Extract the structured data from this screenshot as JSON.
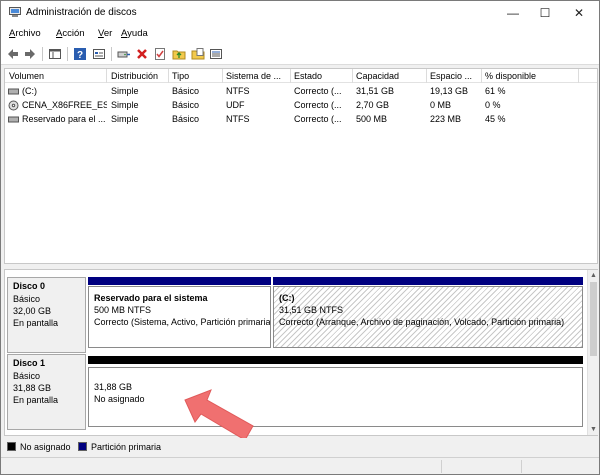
{
  "window": {
    "title": "Administración de discos",
    "minimize": "—",
    "maximize": "☐",
    "close": "✕"
  },
  "menu": [
    {
      "pre": "",
      "key": "A",
      "post": "rchivo"
    },
    {
      "pre": "",
      "key": "A",
      "post": "cción"
    },
    {
      "pre": "",
      "key": "V",
      "post": "er"
    },
    {
      "pre": "",
      "key": "A",
      "post": "yuda"
    }
  ],
  "toolbar": {
    "icons": [
      "back-arrow-icon",
      "forward-arrow-icon",
      "console-view-icon",
      "help-icon",
      "properties-icon",
      "connect-drive-icon",
      "delete-icon",
      "check-icon",
      "folder-up-icon",
      "open-folder-icon",
      "list-view-icon"
    ]
  },
  "volumes": {
    "columns": [
      "Volumen",
      "Distribución",
      "Tipo",
      "Sistema de ...",
      "Estado",
      "Capacidad",
      "Espacio ...",
      "% disponible"
    ],
    "rows": [
      {
        "icon": "volume-icon",
        "volume": "(C:)",
        "layout": "Simple",
        "type": "Básico",
        "fs": "NTFS",
        "status": "Correcto (...",
        "capacity": "31,51 GB",
        "free": "19,13 GB",
        "pct": "61 %"
      },
      {
        "icon": "cd-drive-icon",
        "volume": "CENA_X86FREE_ES...",
        "layout": "Simple",
        "type": "Básico",
        "fs": "UDF",
        "status": "Correcto (...",
        "capacity": "2,70 GB",
        "free": "0 MB",
        "pct": "0 %"
      },
      {
        "icon": "volume-icon",
        "volume": "Reservado para el ...",
        "layout": "Simple",
        "type": "Básico",
        "fs": "NTFS",
        "status": "Correcto (...",
        "capacity": "500 MB",
        "free": "223 MB",
        "pct": "45 %"
      }
    ]
  },
  "disks": [
    {
      "name": "Disco 0",
      "type": "Básico",
      "size": "32,00 GB",
      "state": "En pantalla",
      "partitions": [
        {
          "title": "Reservado para el sistema",
          "size": "500 MB NTFS",
          "status": "Correcto (Sistema, Activo, Partición primaria)"
        },
        {
          "title": "(C:)",
          "size": "31,51 GB NTFS",
          "status": "Correcto (Arranque, Archivo de paginación, Volcado, Partición primaria)"
        }
      ]
    },
    {
      "name": "Disco 1",
      "type": "Básico",
      "size": "31,88 GB",
      "state": "En pantalla",
      "partitions": [
        {
          "title": "",
          "size": "31,88 GB",
          "status": "No asignado"
        }
      ]
    }
  ],
  "legend": [
    {
      "label": "No asignado",
      "color": "#000000"
    },
    {
      "label": "Partición primaria",
      "color": "#000080"
    }
  ],
  "colors": {
    "primary_bar": "#000080",
    "unallocated_bar": "#000000",
    "arrow": "#f07070"
  }
}
